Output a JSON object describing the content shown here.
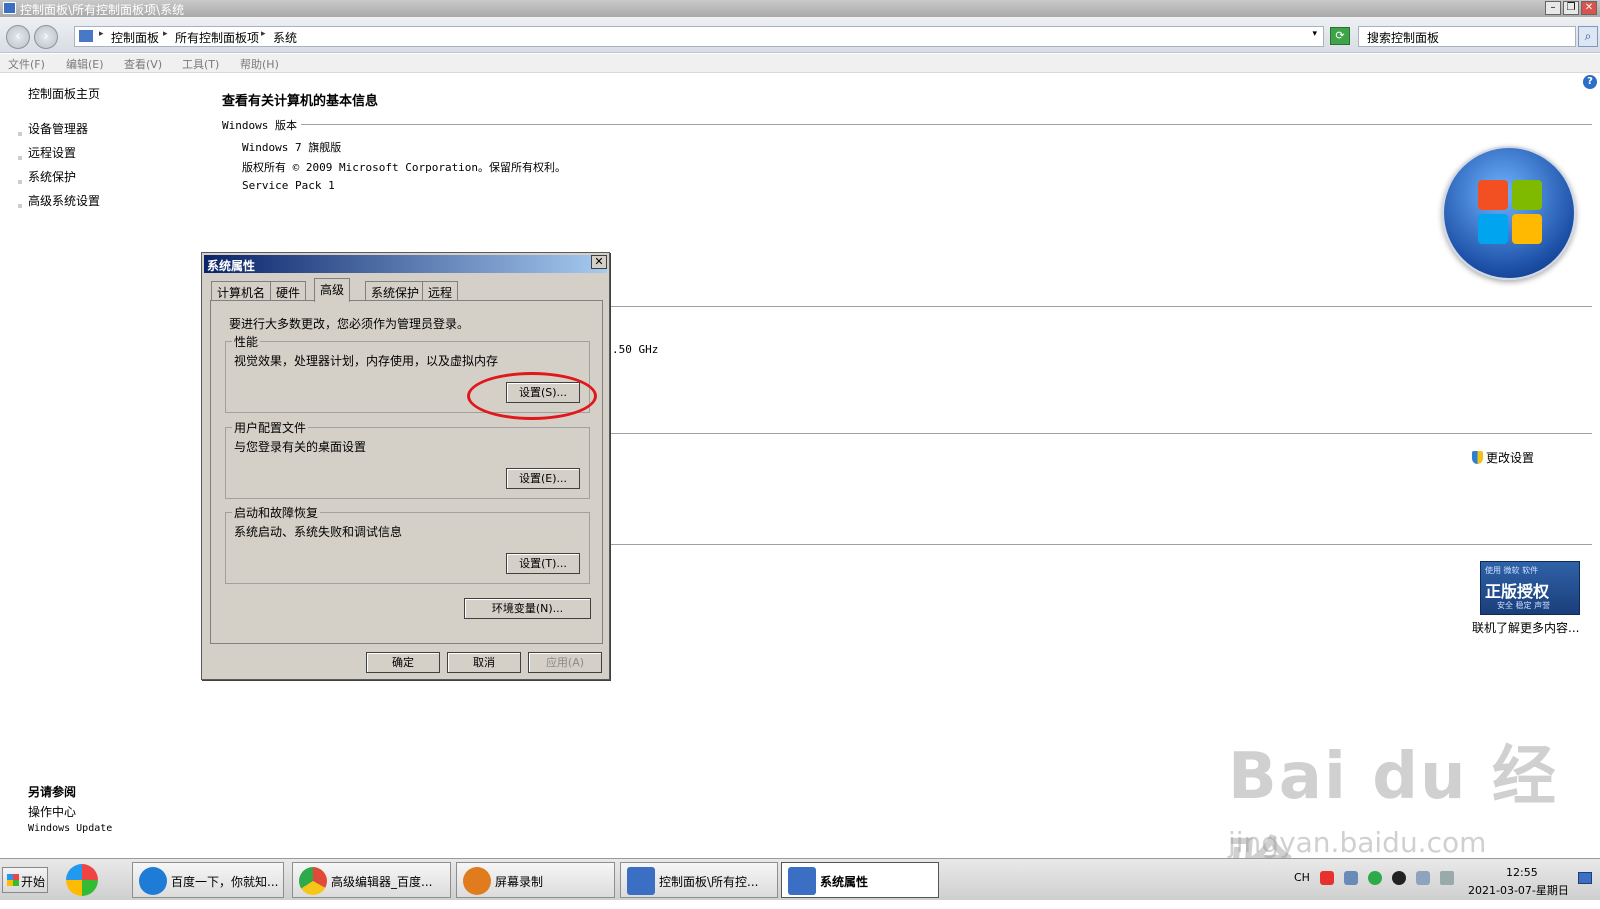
{
  "window": {
    "title": "控制面板\\所有控制面板项\\系统",
    "min_label": "–",
    "max_label": "❐",
    "close_label": "✕"
  },
  "address": {
    "back_label": "‹",
    "forward_label": "›",
    "crumbs": [
      "控制面板",
      "所有控制面板项",
      "系统"
    ],
    "separator": "▸",
    "dropdown": "▾",
    "refresh_label": "⟳",
    "search_placeholder": "搜索控制面板",
    "search_icon": "magnifier-icon",
    "search_glyph": "⌕"
  },
  "menu": [
    "文件(F)",
    "编辑(E)",
    "查看(V)",
    "工具(T)",
    "帮助(H)"
  ],
  "left_pane": {
    "home": "控制面板主页",
    "links": [
      "设备管理器",
      "远程设置",
      "系统保护",
      "高级系统设置"
    ],
    "see_also_title": "另请参阅",
    "see_also": [
      "操作中心",
      "Windows Update"
    ]
  },
  "main": {
    "title": "查看有关计算机的基本信息",
    "edition_section": "Windows 版本",
    "edition": "Windows 7 旗舰版",
    "copyright": "版权所有 © 2009 Microsoft Corporation。保留所有权利。",
    "service_pack": "Service Pack 1",
    "cpu_partial": ".50 GHz",
    "change_settings": "更改设置",
    "help_label": "?"
  },
  "genuine": {
    "line1": "使用 微软 软件",
    "line2": "正版授权",
    "line3": "安全 稳定 声誉",
    "link": "联机了解更多内容..."
  },
  "dialog": {
    "title": "系统属性",
    "close_label": "✕",
    "tabs": [
      "计算机名",
      "硬件",
      "高级",
      "系统保护",
      "远程"
    ],
    "active_tab": "高级",
    "admin_note": "要进行大多数更改，您必须作为管理员登录。",
    "groups": [
      {
        "title": "性能",
        "desc": "视觉效果，处理器计划，内存使用，以及虚拟内存",
        "button": "设置(S)..."
      },
      {
        "title": "用户配置文件",
        "desc": "与您登录有关的桌面设置",
        "button": "设置(E)..."
      },
      {
        "title": "启动和故障恢复",
        "desc": "系统启动、系统失败和调试信息",
        "button": "设置(T)..."
      }
    ],
    "env_button": "环境变量(N)...",
    "ok": "确定",
    "cancel": "取消",
    "apply": "应用(A)",
    "highlight_color": "#e0181c"
  },
  "taskbar": {
    "start": "开始",
    "tasks": [
      {
        "label": "百度一下，你就知...",
        "icon": "ie-icon",
        "color": "#1e7bd6"
      },
      {
        "label": "高级编辑器_百度...",
        "icon": "chrome-icon",
        "color": "#e04a3a"
      },
      {
        "label": "屏幕录制",
        "icon": "recorder-icon",
        "color": "#e07b1e"
      },
      {
        "label": "控制面板\\所有控...",
        "icon": "control-panel-icon",
        "color": "#3a6fc4"
      },
      {
        "label": "系统属性",
        "icon": "system-properties-icon",
        "color": "#3a6fc4"
      }
    ],
    "lang": "CH",
    "time": "12:55",
    "date": "2021-03-07-星期日"
  },
  "watermark": {
    "text": "Bai du 经验",
    "url": "jingyan.baidu.com"
  }
}
